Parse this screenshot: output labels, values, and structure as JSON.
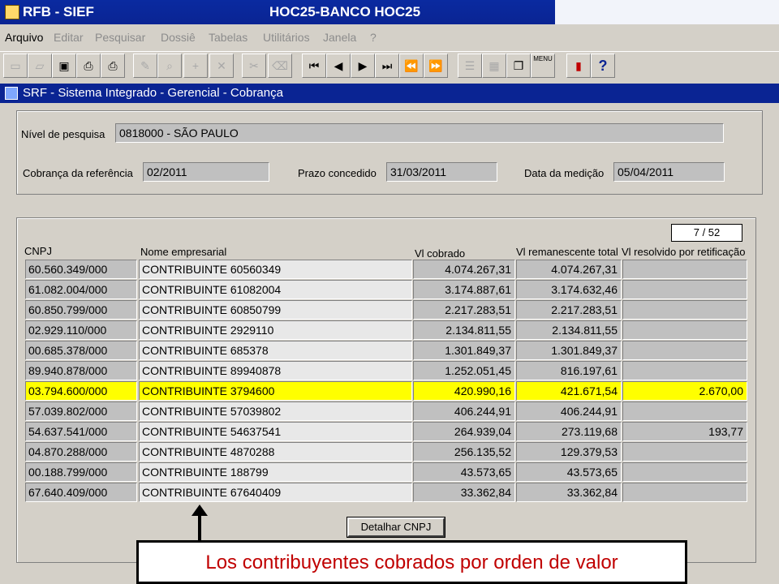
{
  "window": {
    "app_title": "RFB -  SIEF",
    "db_title": "HOC25-BANCO HOC25"
  },
  "menu": [
    "Arquivo",
    "Editar",
    "Pesquisar",
    "Dossiê",
    "Tabelas",
    "Utilitários",
    "Janela",
    "?"
  ],
  "toolbar": {
    "icons": [
      "new-icon",
      "open-icon",
      "save-icon",
      "print-icon",
      "print-preview-icon",
      "edit-icon",
      "query-icon",
      "insert-icon",
      "delete-icon",
      "cut-icon",
      "clear-icon",
      "first-record-icon",
      "previous-record-icon",
      "next-record-icon",
      "last-record-icon",
      "previous-set-icon",
      "next-set-icon",
      "list-icon",
      "calculator-icon",
      "window-icon",
      "menu-icon",
      "exit-icon",
      "help-icon"
    ],
    "menu_label": "MENU",
    "help_label": "?"
  },
  "inner_window": {
    "title": "SRF - Sistema Integrado - Gerencial - Cobrança"
  },
  "header": {
    "nivel_label": "Nível de pesquisa",
    "nivel_value": "0818000 - SÃO PAULO",
    "referencia_label": "Cobrança da referência",
    "referencia_value": "02/2011",
    "prazo_label": "Prazo concedido",
    "prazo_value": "31/03/2011",
    "medicao_label": "Data da medição",
    "medicao_value": "05/04/2011"
  },
  "table": {
    "counter": "7  /  52",
    "columns": [
      "CNPJ",
      "Nome empresarial",
      "Vl cobrado",
      "Vl remanescente total",
      "Vl resolvido por retificação"
    ],
    "rows": [
      {
        "cnpj": "60.560.349/000",
        "nome": "CONTRIBUINTE 60560349",
        "cobrado": "4.074.267,31",
        "remanescente": "4.074.267,31",
        "resolvido": ""
      },
      {
        "cnpj": "61.082.004/000",
        "nome": "CONTRIBUINTE 61082004",
        "cobrado": "3.174.887,61",
        "remanescente": "3.174.632,46",
        "resolvido": ""
      },
      {
        "cnpj": "60.850.799/000",
        "nome": "CONTRIBUINTE 60850799",
        "cobrado": "2.217.283,51",
        "remanescente": "2.217.283,51",
        "resolvido": ""
      },
      {
        "cnpj": "02.929.110/000",
        "nome": "CONTRIBUINTE 2929110",
        "cobrado": "2.134.811,55",
        "remanescente": "2.134.811,55",
        "resolvido": ""
      },
      {
        "cnpj": "00.685.378/000",
        "nome": "CONTRIBUINTE 685378",
        "cobrado": "1.301.849,37",
        "remanescente": "1.301.849,37",
        "resolvido": ""
      },
      {
        "cnpj": "89.940.878/000",
        "nome": "CONTRIBUINTE 89940878",
        "cobrado": "1.252.051,45",
        "remanescente": "816.197,61",
        "resolvido": ""
      },
      {
        "cnpj": "03.794.600/000",
        "nome": "CONTRIBUINTE 3794600",
        "cobrado": "420.990,16",
        "remanescente": "421.671,54",
        "resolvido": "2.670,00"
      },
      {
        "cnpj": "57.039.802/000",
        "nome": "CONTRIBUINTE 57039802",
        "cobrado": "406.244,91",
        "remanescente": "406.244,91",
        "resolvido": ""
      },
      {
        "cnpj": "54.637.541/000",
        "nome": "CONTRIBUINTE 54637541",
        "cobrado": "264.939,04",
        "remanescente": "273.119,68",
        "resolvido": "193,77"
      },
      {
        "cnpj": "04.870.288/000",
        "nome": "CONTRIBUINTE 4870288",
        "cobrado": "256.135,52",
        "remanescente": "129.379,53",
        "resolvido": ""
      },
      {
        "cnpj": "00.188.799/000",
        "nome": "CONTRIBUINTE 188799",
        "cobrado": "43.573,65",
        "remanescente": "43.573,65",
        "resolvido": ""
      },
      {
        "cnpj": "67.640.409/000",
        "nome": "CONTRIBUINTE 67640409",
        "cobrado": "33.362,84",
        "remanescente": "33.362,84",
        "resolvido": ""
      }
    ],
    "highlight_color": "#ffff00"
  },
  "detail_button": "Detalhar CNPJ",
  "annotation": {
    "caption": "Los contribuyentes cobrados por orden de valor",
    "caption_color": "#c00000"
  }
}
